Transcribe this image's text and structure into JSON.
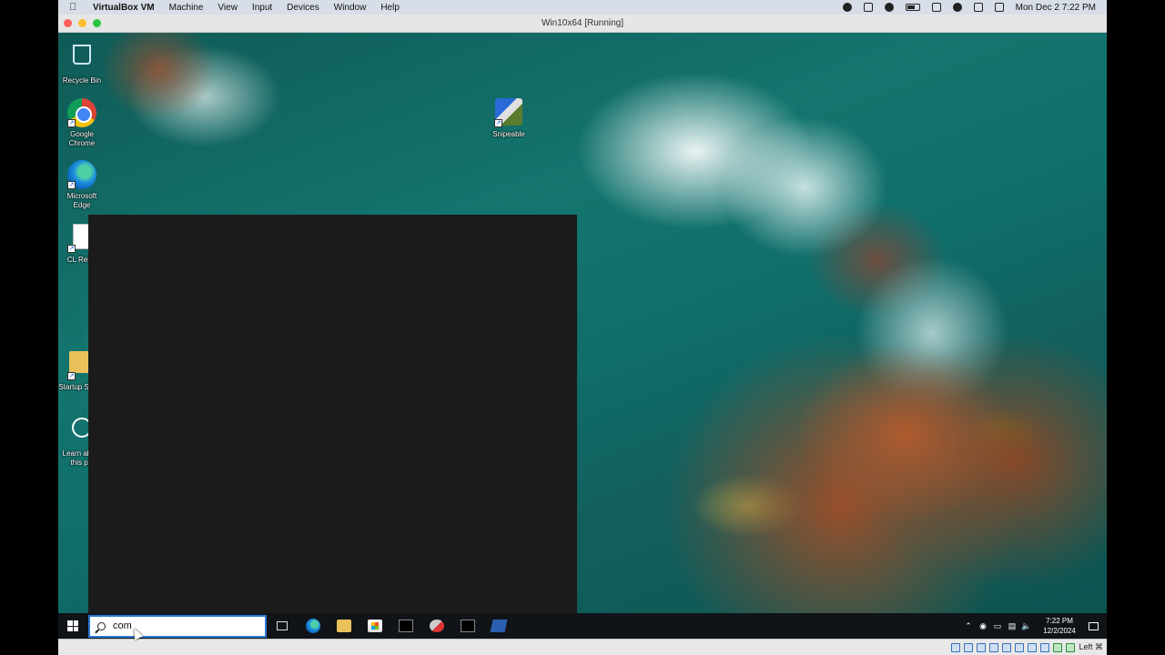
{
  "mac_menubar": {
    "app_name": "VirtualBox VM",
    "menus": [
      "Machine",
      "View",
      "Input",
      "Devices",
      "Window",
      "Help"
    ],
    "datetime": "Mon Dec 2  7:22 PM"
  },
  "vm_window": {
    "title": "Win10x64 [Running]"
  },
  "desktop_icons": [
    {
      "label": "Recycle Bin"
    },
    {
      "label": "Google Chrome"
    },
    {
      "label": "Microsoft Edge"
    },
    {
      "label": "CL RePo"
    },
    {
      "label": "Startup Shortc"
    },
    {
      "label": "Learn about this pic"
    },
    {
      "label": "Snipeable"
    }
  ],
  "taskbar": {
    "search_value": "com",
    "apps": [
      "task-view",
      "edge",
      "file-explorer",
      "microsoft-store",
      "terminal",
      "snipping",
      "powershell"
    ],
    "clock_time": "7:22 PM",
    "clock_date": "12/2/2024"
  },
  "vbox_statusbar": {
    "host_key": "Left ⌘"
  }
}
